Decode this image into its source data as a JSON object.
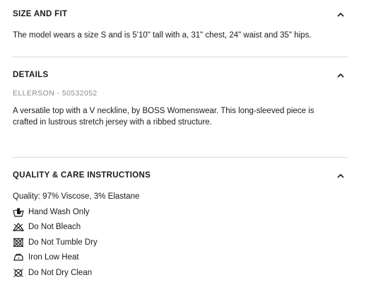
{
  "sections": {
    "size_fit": {
      "title": "SIZE AND FIT",
      "text": "The model wears a size S and is 5'10\" tall with a, 31\" chest, 24\" waist and 35\" hips."
    },
    "details": {
      "title": "DETAILS",
      "sku": "ELLERSON - 50532052",
      "text": "A versatile top with a V neckline, by BOSS Womenswear. This long-sleeved piece is crafted in lustrous stretch jersey with a ribbed structure."
    },
    "quality": {
      "title": "QUALITY & CARE INSTRUCTIONS",
      "composition": "Quality: 97% Viscose, 3% Elastane",
      "care": [
        {
          "label": "Hand Wash Only",
          "icon": "hand-wash-icon"
        },
        {
          "label": "Do Not Bleach",
          "icon": "no-bleach-icon"
        },
        {
          "label": "Do Not Tumble Dry",
          "icon": "no-tumble-dry-icon"
        },
        {
          "label": "Iron Low Heat",
          "icon": "iron-low-icon"
        },
        {
          "label": "Do Not Dry Clean",
          "icon": "no-dry-clean-icon"
        }
      ]
    }
  }
}
